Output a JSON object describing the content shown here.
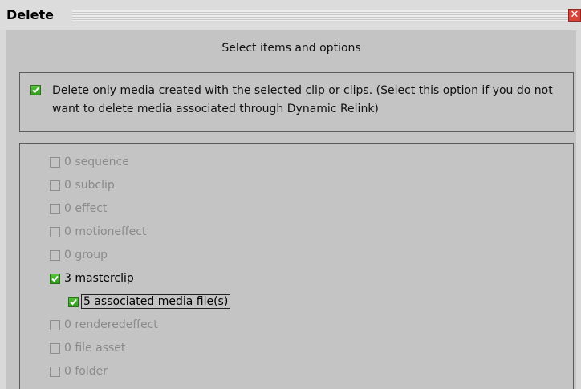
{
  "window": {
    "title": "Delete",
    "close_glyph": "✕"
  },
  "heading": "Select items and options",
  "option": {
    "checked": true,
    "text": "Delete only media created with the selected clip or clips. (Select this option if you do not want to delete media associated through Dynamic Relink)"
  },
  "items": [
    {
      "label": "0 sequence",
      "checked": false,
      "enabled": false
    },
    {
      "label": "0 subclip",
      "checked": false,
      "enabled": false
    },
    {
      "label": "0 effect",
      "checked": false,
      "enabled": false
    },
    {
      "label": "0 motioneffect",
      "checked": false,
      "enabled": false
    },
    {
      "label": "0 group",
      "checked": false,
      "enabled": false
    },
    {
      "label": "3 masterclip",
      "checked": true,
      "enabled": true
    },
    {
      "label": "5 associated media file(s)",
      "checked": true,
      "enabled": true,
      "focused": true
    },
    {
      "label": "0 renderedeffect",
      "checked": false,
      "enabled": false
    },
    {
      "label": "0 file asset",
      "checked": false,
      "enabled": false
    },
    {
      "label": "0 folder",
      "checked": false,
      "enabled": false
    }
  ],
  "colors": {
    "checkbox_green": "#3fae26",
    "disabled_text": "#8a8a8a",
    "close_red": "#d9443a"
  }
}
